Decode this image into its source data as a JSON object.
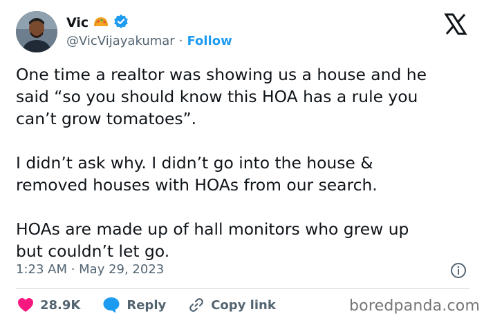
{
  "author": {
    "name": "Vic",
    "handle": "@VicVijayakumar",
    "separator": "·",
    "follow_label": "Follow",
    "badge_icon": "taco-emoji-icon",
    "verified_icon": "verified-badge-icon"
  },
  "tweet": {
    "paragraphs": [
      "One time a realtor was showing us a house and he\nsaid “so you should know this HOA has a rule you\ncan’t grow tomatoes”.",
      "I didn’t ask why. I didn’t go into the house &\nremoved houses with HOAs from our search.",
      "HOAs are made up of hall monitors who grew up\nbut couldn’t let go."
    ],
    "timestamp": "1:23 AM · May 29, 2023"
  },
  "actions": {
    "likes": "28.9K",
    "reply_label": "Reply",
    "copy_link_label": "Copy link"
  },
  "watermark": "boredpanda.com",
  "colors": {
    "accent": "#1d9bf0",
    "like": "#f91880",
    "text": "#0f1419",
    "muted": "#536471"
  }
}
